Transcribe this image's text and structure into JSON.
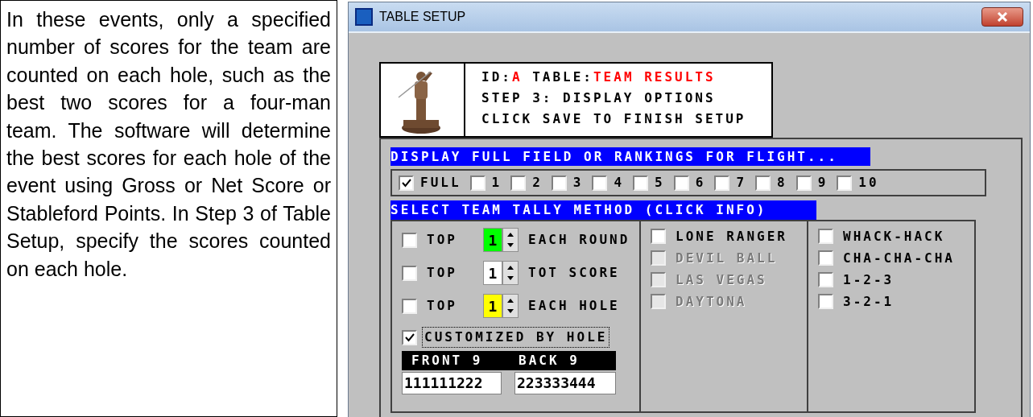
{
  "description": "In these events, only a specified number of scores for the team are counted on each hole, such as the best two scores for a four-man team.  The software will determine the best scores for each hole of the event using Gross or Net Score or Stableford Points.  In Step 3 of Table Setup, specify the scores counted on each hole.",
  "window": {
    "title": "TABLE SETUP"
  },
  "header": {
    "picture": {
      "kind": "picture"
    },
    "id_label": "ID:",
    "id": "A",
    "table_label": " TABLE:",
    "table": "TEAM RESULTS",
    "lines": [
      "STEP 3: DISPLAY OPTIONS",
      "CLICK SAVE TO FINISH SETUP"
    ]
  },
  "flight": {
    "heading": "DISPLAY FULL FIELD OR RANKINGS FOR FLIGHT...",
    "options": [
      {
        "label": "FULL",
        "checked": true
      },
      {
        "label": "1",
        "checked": false
      },
      {
        "label": "2",
        "checked": false
      },
      {
        "label": "3",
        "checked": false
      },
      {
        "label": "4",
        "checked": false
      },
      {
        "label": "5",
        "checked": false
      },
      {
        "label": "6",
        "checked": false
      },
      {
        "label": "7",
        "checked": false
      },
      {
        "label": "8",
        "checked": false
      },
      {
        "label": "9",
        "checked": false
      },
      {
        "label": "10",
        "checked": false
      }
    ]
  },
  "tally": {
    "heading": "SELECT TEAM TALLY METHOD (CLICK INFO)",
    "top_rows": [
      {
        "label": "TOP",
        "value": "1",
        "color": "#00ff00",
        "suffix": "EACH ROUND",
        "checked": false
      },
      {
        "label": "TOP",
        "value": "1",
        "color": "#ffffff",
        "suffix": "TOT SCORE",
        "checked": false
      },
      {
        "label": "TOP",
        "value": "1",
        "color": "#ffff00",
        "suffix": "EACH HOLE",
        "checked": false
      }
    ],
    "customized": {
      "label": "CUSTOMIZED BY HOLE",
      "checked": true
    },
    "front_label": "FRONT 9",
    "back_label": "BACK 9",
    "front_value": "111111222",
    "back_value": "223333444",
    "columns": [
      [
        {
          "label": "LONE RANGER",
          "checked": false,
          "disabled": false
        },
        {
          "label": "DEVIL BALL",
          "checked": false,
          "disabled": true
        },
        {
          "label": "LAS VEGAS",
          "checked": false,
          "disabled": true
        },
        {
          "label": "DAYTONA",
          "checked": false,
          "disabled": true
        }
      ],
      [
        {
          "label": "WHACK-HACK",
          "checked": false,
          "disabled": false
        },
        {
          "label": "CHA-CHA-CHA",
          "checked": false,
          "disabled": false
        },
        {
          "label": "1-2-3",
          "checked": false,
          "disabled": false
        },
        {
          "label": "3-2-1",
          "checked": false,
          "disabled": false
        }
      ]
    ]
  }
}
